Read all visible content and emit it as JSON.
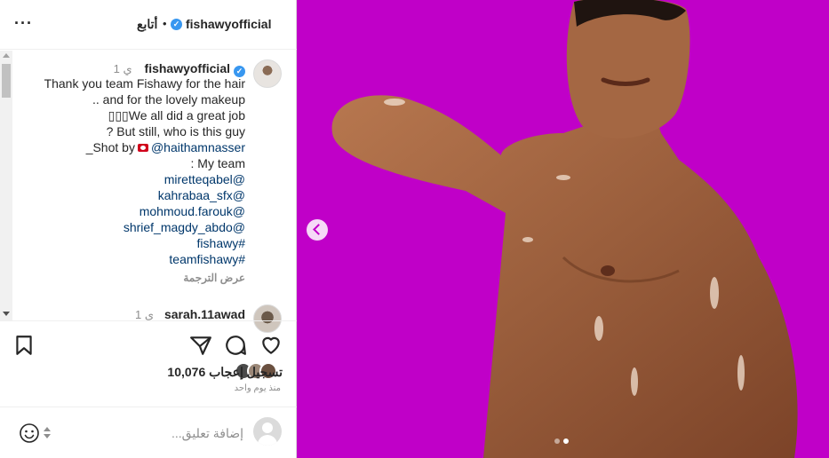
{
  "header": {
    "username": "fishawyofficial",
    "verified_glyph": "✓",
    "separator": "•",
    "follow_label": "أتابع",
    "more_label": "···"
  },
  "caption": {
    "username": "fishawyofficial",
    "time": "1 ي",
    "lines": [
      "Thank you team Fishawy for the hair",
      ".. and for the lovely makeup",
      "We all did a great job",
      "? But still, who is this guy",
      "_Shot by",
      ": My team"
    ],
    "emoji_placeholder": "▯▯▯",
    "shot_by_handle": "@haithamnasser",
    "tags": [
      "miretteqabel@",
      "kahrabaa_sfx@",
      "mohmoud.farouk@",
      "shrief_magdy_abdo@",
      "fishawy#",
      "teamfishawy#"
    ],
    "see_translation": "عرض الترجمة"
  },
  "reply": {
    "username": "sarah.11awad",
    "time": "1 ي"
  },
  "actions": {
    "likes_count": "10,076",
    "likes_label": "تسجيل إعجاب",
    "date": "منذ يوم واحد"
  },
  "add_comment": {
    "placeholder": "...إضافة تعليق"
  },
  "icons": [
    "more-icon",
    "verified-icon",
    "bookmark-icon",
    "share-icon",
    "comment-icon",
    "heart-icon",
    "emoji-icon",
    "chevron-left-icon"
  ],
  "colors": {
    "media_background": "#c000c8",
    "link": "#00376b",
    "verified": "#3897f0",
    "muted": "#8e8e8e"
  },
  "carousel": {
    "total": 2,
    "current": 2
  }
}
